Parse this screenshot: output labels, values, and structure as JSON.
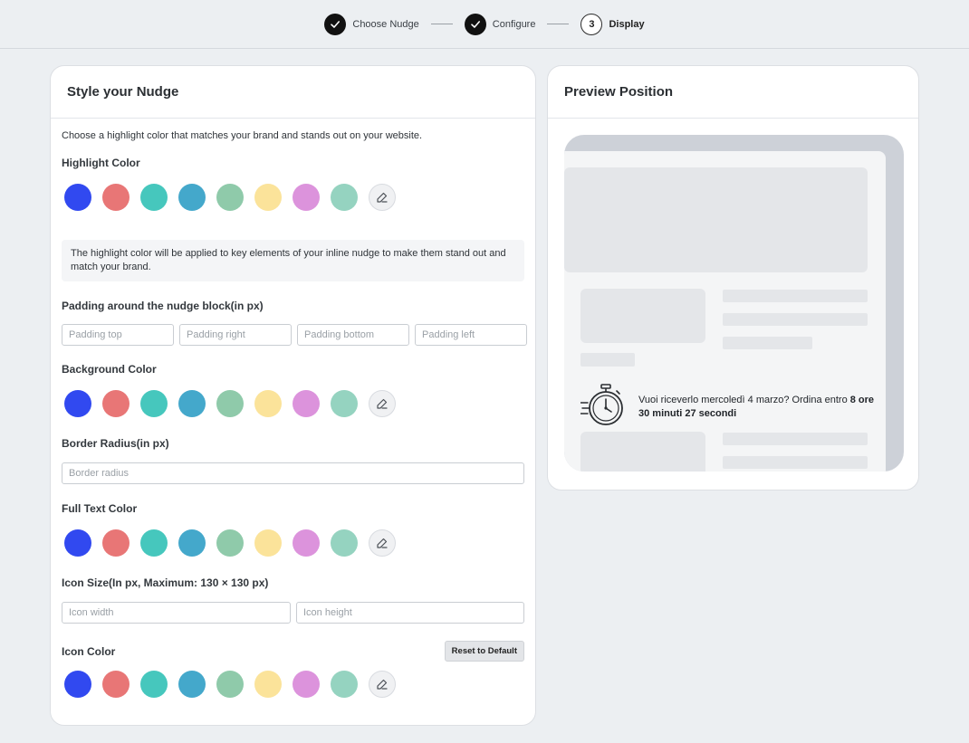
{
  "stepper": {
    "steps": [
      {
        "label": "Choose Nudge",
        "state": "done"
      },
      {
        "label": "Configure",
        "state": "done"
      },
      {
        "label": "Display",
        "state": "current",
        "number": "3"
      }
    ]
  },
  "style_panel": {
    "title": "Style your Nudge",
    "description": "Choose a highlight color that matches your brand and stands out on your website.",
    "highlight_label": "Highlight Color",
    "info_text": "The highlight color will be applied to key elements of your inline nudge to make them stand out and match your brand.",
    "padding_label": "Padding around the nudge block(in px)",
    "padding_placeholders": {
      "top": "Padding top",
      "right": "Padding right",
      "bottom": "Padding bottom",
      "left": "Padding left"
    },
    "background_label": "Background Color",
    "border_radius_label": "Border Radius(in px)",
    "border_radius_placeholder": "Border radius",
    "text_color_label": "Full Text Color",
    "icon_size_label": "Icon Size(In px, Maximum: 130 × 130 px)",
    "icon_width_placeholder": "Icon width",
    "icon_height_placeholder": "Icon height",
    "icon_color_label": "Icon Color",
    "reset_label": "Reset to Default",
    "palette": [
      "#3149f0",
      "#e87676",
      "#46c7bd",
      "#44a8cb",
      "#8fcaaa",
      "#fbe39a",
      "#dc93dc",
      "#95d3c0"
    ],
    "custom_icon": "pencil-edit-icon"
  },
  "preview_panel": {
    "title": "Preview Position",
    "nudge_text_plain": "Vuoi riceverlo mercoledì 4 marzo? Ordina entro ",
    "nudge_text_bold": "8 ore 30 minuti 27 secondi",
    "nudge_icon": "stopwatch-icon"
  }
}
